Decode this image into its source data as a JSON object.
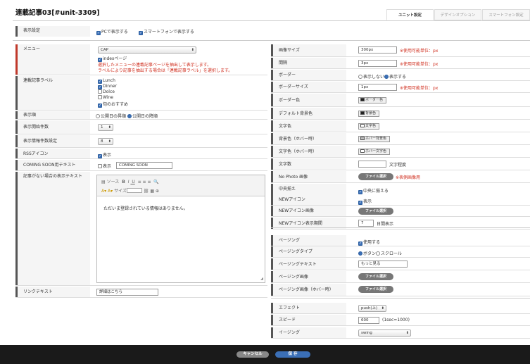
{
  "header": {
    "title": "連載記事03[#unit-3309]",
    "tabs": [
      "ユニット設定",
      "デザインオプション",
      "スマートフォン設定"
    ]
  },
  "display": {
    "label": "表示設定",
    "pc": "PCで表示する",
    "sp": "スマートフォンで表示する"
  },
  "menu": {
    "label": "メニュー",
    "selected": "CAP",
    "index_page": "indexページ",
    "note1": "選択したメニューの連載記事ページを抽出して表示します。",
    "note2": "ラベルにより記事を抽出する場合は「連載記事ラベル」を選択します。"
  },
  "labels": {
    "label": "連載記事ラベル",
    "items": [
      {
        "text": "Lunch",
        "on": true
      },
      {
        "text": "Dinner",
        "on": true
      },
      {
        "text": "Dolce",
        "on": false
      },
      {
        "text": "Wine",
        "on": false
      },
      {
        "text": "旬のおすすめ",
        "on": true
      }
    ]
  },
  "order": {
    "label": "表示順",
    "asc": "公開日の昇順",
    "desc": "公開日の降順"
  },
  "start": {
    "label": "表示開始件数",
    "value": "1"
  },
  "count": {
    "label": "表示情報件数設定",
    "value": "8"
  },
  "rss": {
    "label": "RSSアイコン",
    "text": "表示"
  },
  "coming": {
    "label": "COMING SOON用テキスト",
    "check": "表示",
    "value": "COMING SOON"
  },
  "noarticle": {
    "label": "記事がない場合の表示テキスト",
    "editor_text": "ただいま登録されている情報はありません。",
    "tb_source": "ソース",
    "tb_size": "サイズ"
  },
  "link": {
    "label": "リンクテキスト",
    "value": "詳細はこちら"
  },
  "right": {
    "imgsize": {
      "label": "画像サイズ",
      "value": "300px",
      "note": "※使用可能単位：px"
    },
    "gap": {
      "label": "間隔",
      "value": "3px",
      "note": "※使用可能単位：px"
    },
    "border": {
      "label": "ボーダー",
      "off": "表示しない",
      "on": "表示する"
    },
    "bsize": {
      "label": "ボーダーサイズ",
      "value": "1px",
      "note": "※使用可能単位：px"
    },
    "bcolor": {
      "label": "ボーダー色",
      "btn": "ボーダー色"
    },
    "bg": {
      "label": "デフォルト背景色",
      "btn": "背景色"
    },
    "tcolor": {
      "label": "文字色",
      "btn": "文字色"
    },
    "hbg": {
      "label": "背景色（ホバー時）",
      "btn": "ホバー背景色"
    },
    "htc": {
      "label": "文字色（ホバー時）",
      "btn": "ホバー文字色"
    },
    "chars": {
      "label": "文字数",
      "suffix": "文字程度"
    },
    "nophoto": {
      "label": "No Photo 画像",
      "btn": "ファイル選択",
      "note": "※表側画像用"
    },
    "center": {
      "label": "中央揃え",
      "text": "中央に揃える"
    },
    "newicon": {
      "label": "NEWアイコン",
      "text": "表示"
    },
    "newimg": {
      "label": "NEWアイコン画像",
      "btn": "ファイル選択"
    },
    "newdays": {
      "label": "NEWアイコン表示期間",
      "value": "7",
      "suffix": "日間表示"
    },
    "paging": {
      "label": "ページング",
      "text": "使用する"
    },
    "ptype": {
      "label": "ページングタイプ",
      "btn": "ボタン",
      "scroll": "スクロール"
    },
    "ptext": {
      "label": "ページングテキスト",
      "value": "もっと見る"
    },
    "pimg": {
      "label": "ページング画像",
      "btn": "ファイル選択"
    },
    "phover": {
      "label": "ページング画像（ホバー時）",
      "btn": "ファイル選択"
    },
    "effect": {
      "label": "エフェクト",
      "value": "push(上)"
    },
    "speed": {
      "label": "スピード",
      "value": "600",
      "suffix": "(1sec=1000)"
    },
    "easing": {
      "label": "イージング",
      "value": "swing"
    }
  },
  "footer": {
    "cancel": "キャンセル",
    "save": "保 存"
  }
}
